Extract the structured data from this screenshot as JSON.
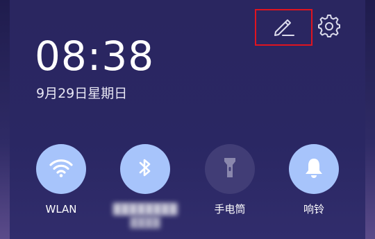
{
  "status": {
    "time": "08:38",
    "date": "9月29日星期日"
  },
  "header": {
    "edit_icon": "pencil-icon",
    "settings_icon": "gear-icon"
  },
  "toggles": [
    {
      "label": "WLAN",
      "icon": "wifi-icon",
      "active": true
    },
    {
      "label": "",
      "icon": "bluetooth-icon",
      "active": true,
      "label_obscured": true
    },
    {
      "label": "手电筒",
      "icon": "flashlight-icon",
      "active": false
    },
    {
      "label": "响铃",
      "icon": "bell-icon",
      "active": true
    }
  ],
  "colors": {
    "active_tile": "#a7c4fb",
    "inactive_tile": "#413d76",
    "highlight_box": "#e0141f",
    "background": "#2a2660"
  }
}
